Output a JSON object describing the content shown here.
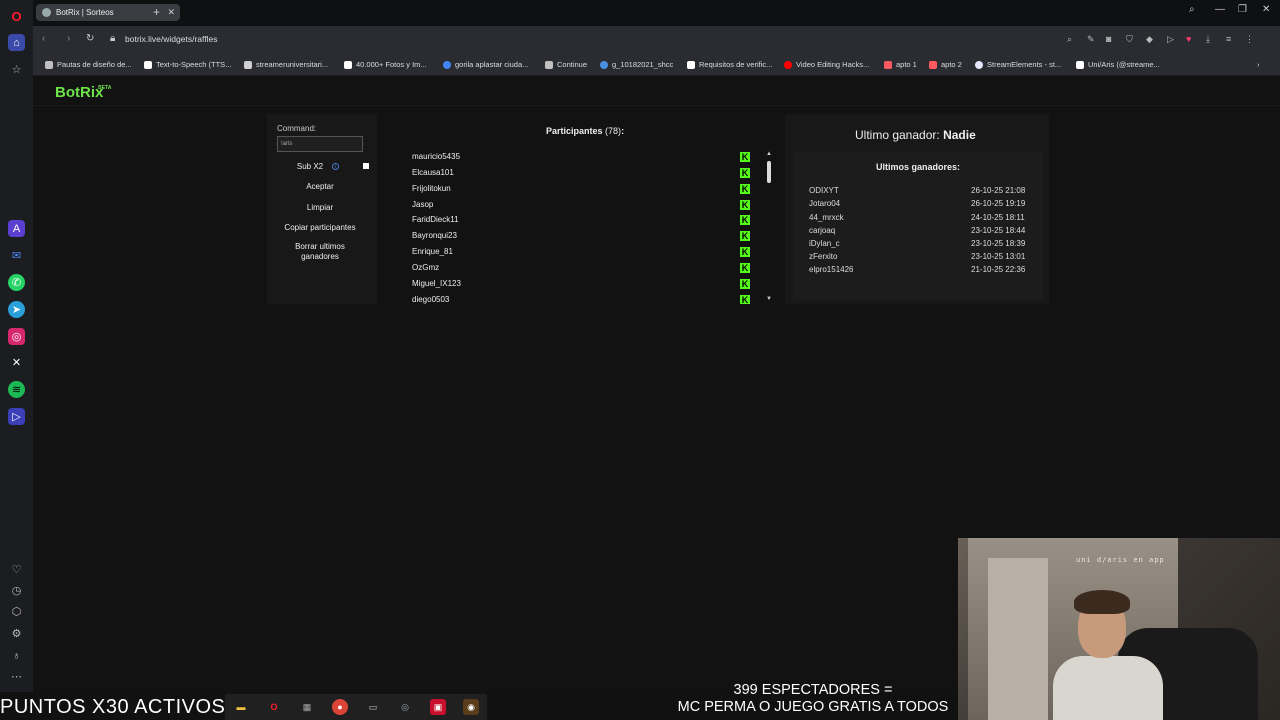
{
  "browser": {
    "tab_title": "BotRix | Sorteos",
    "tab_close": "✕",
    "new_tab": "+",
    "url": "botrix.live/widgets/raffles",
    "bookmarks": [
      {
        "label": "Pautas de diseño de...",
        "color": "#c0c0c0"
      },
      {
        "label": "Text-to-Speech (TTS...",
        "color": "#ffffff"
      },
      {
        "label": "streameruniversitari...",
        "color": "#d0d0d0"
      },
      {
        "label": "40.000+ Fotos y Im...",
        "color": "#ffffff"
      },
      {
        "label": "gorila aplastar ciuda...",
        "color": "#4285f4"
      },
      {
        "label": "Continue",
        "color": "#c0c0c0"
      },
      {
        "label": "g_10182021_shcc",
        "color": "#4a90e2"
      },
      {
        "label": "Requisitos de verific...",
        "color": "#ffffff"
      },
      {
        "label": "Video Editing Hacks...",
        "color": "#ff0000"
      },
      {
        "label": "apto 1",
        "color": "#ff5a5f"
      },
      {
        "label": "apto 2",
        "color": "#ff5a5f"
      },
      {
        "label": "StreamElements - st...",
        "color": "#e6e6ff"
      },
      {
        "label": "Uni/Aris (@streame...",
        "color": "#ffffff"
      }
    ]
  },
  "app": {
    "brand": "BotRix",
    "brand_badge": "BETA"
  },
  "controls": {
    "command_label": "Command:",
    "command_value": "!aris",
    "sub_label": "Sub X2",
    "info_symbol": "i",
    "aceptar": "Aceptar",
    "limpiar": "Limpiar",
    "copiar": "Copiar participantes",
    "borrar_line1": "Borrar ultimos",
    "borrar_line2": "ganadores"
  },
  "participants": {
    "title": "Participantes",
    "count": "(78)",
    "colon": ":",
    "platform_badge": "K",
    "names": [
      "mauricio5435",
      "Elcausa101",
      "Frijolitokun",
      "Jasop",
      "FaridDieck11",
      "Bayronqui23",
      "Enrique_81",
      "OzGmz",
      "Miguel_IX123",
      "diego0503"
    ]
  },
  "winner": {
    "label": "Ultimo ganador:",
    "name": "Nadie",
    "list_title": "Ultimos ganadores:",
    "recent": [
      {
        "name": "ODIXYT",
        "date": "26-10-25 21:08"
      },
      {
        "name": "Jotaro04",
        "date": "26-10-25 19:19"
      },
      {
        "name": "44_mrxck",
        "date": "24-10-25 18:11"
      },
      {
        "name": "carjoaq",
        "date": "23-10-25 18:44"
      },
      {
        "name": "iDylan_c",
        "date": "23-10-25 18:39"
      },
      {
        "name": "zFerxito",
        "date": "23-10-25 13:01"
      },
      {
        "name": "elpro151426",
        "date": "21-10-25 22:36"
      }
    ]
  },
  "stream_overlay": {
    "points": "PUNTOS X30 ACTIVOS",
    "viewers_line1": "399 ESPECTADORES =",
    "viewers_line2": "MC PERMA O JUEGO GRATIS A TODOS",
    "cam_caption": "uni d/aris en app"
  }
}
